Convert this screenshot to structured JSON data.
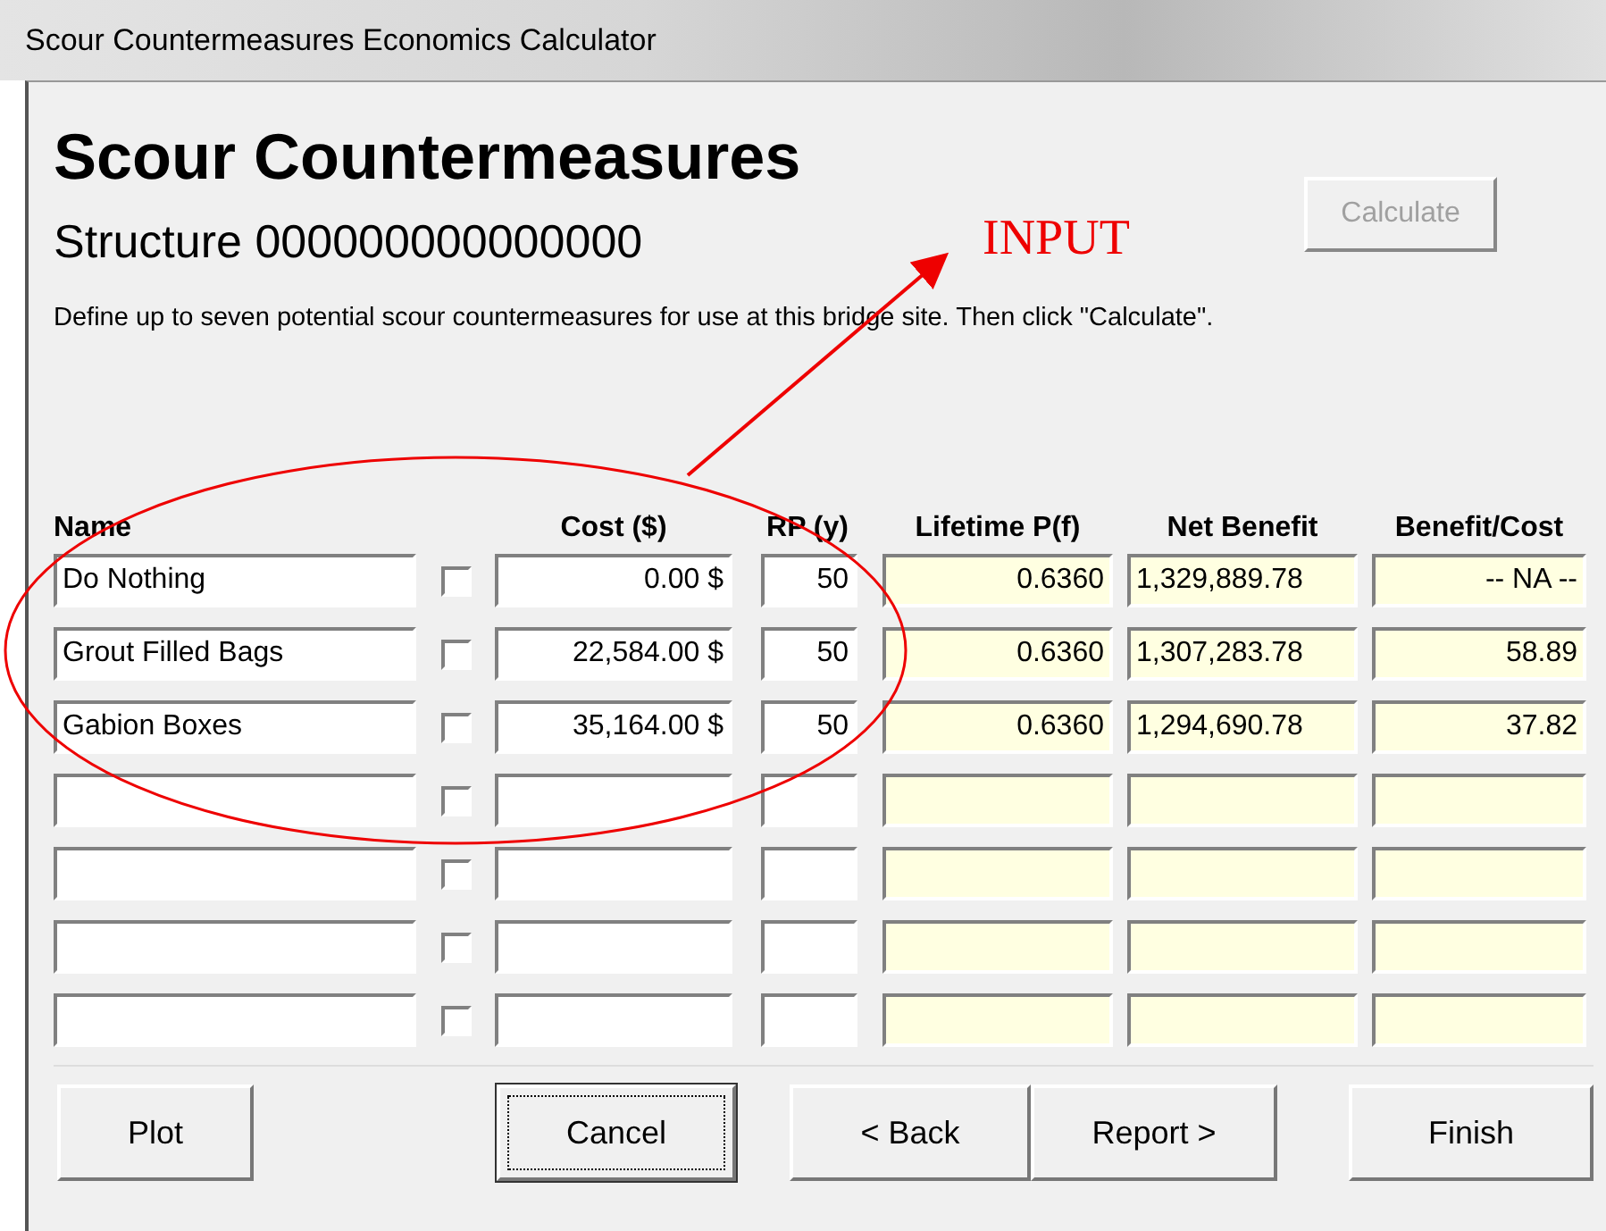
{
  "window": {
    "title": "Scour Countermeasures Economics Calculator"
  },
  "heading": "Scour Countermeasures",
  "structure": "Structure 000000000000000",
  "calculate_button": {
    "label": "Calculate",
    "disabled": true
  },
  "instructions": "Define up to seven potential scour countermeasures for use at this bridge site.  Then click \"Calculate\".",
  "annotation": {
    "label": "INPUT"
  },
  "table": {
    "columns": [
      "Name",
      "Cost ($)",
      "RP (y)",
      "Lifetime P(f)",
      "Net Benefit",
      "Benefit/Cost"
    ],
    "rows": [
      {
        "name": "Do Nothing",
        "checked": false,
        "cost": "0.00 $",
        "rp": "50",
        "lifetime_pf": "0.6360",
        "net_benefit": "1,329,889.78",
        "benefit_cost": "-- NA --"
      },
      {
        "name": "Grout Filled Bags",
        "checked": false,
        "cost": "22,584.00 $",
        "rp": "50",
        "lifetime_pf": "0.6360",
        "net_benefit": "1,307,283.78",
        "benefit_cost": "58.89"
      },
      {
        "name": "Gabion Boxes",
        "checked": false,
        "cost": "35,164.00 $",
        "rp": "50",
        "lifetime_pf": "0.6360",
        "net_benefit": "1,294,690.78",
        "benefit_cost": "37.82"
      },
      {
        "checked": false
      },
      {
        "checked": false
      },
      {
        "checked": false
      },
      {
        "checked": false
      }
    ]
  },
  "buttons": [
    {
      "label": "Plot",
      "focused": false
    },
    {
      "label": "Cancel",
      "focused": true
    },
    {
      "label": "< Back",
      "focused": false
    },
    {
      "label": "Report >",
      "focused": false
    },
    {
      "label": "Finish",
      "focused": false
    }
  ]
}
